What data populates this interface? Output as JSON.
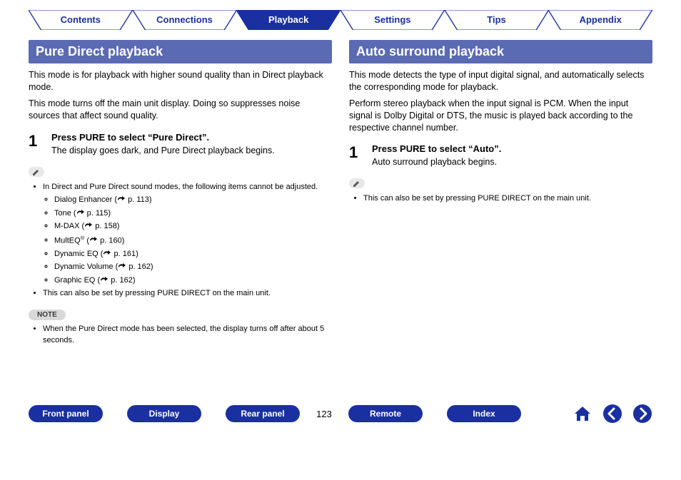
{
  "tabs": [
    {
      "label": "Contents",
      "active": false
    },
    {
      "label": "Connections",
      "active": false
    },
    {
      "label": "Playback",
      "active": true
    },
    {
      "label": "Settings",
      "active": false
    },
    {
      "label": "Tips",
      "active": false
    },
    {
      "label": "Appendix",
      "active": false
    }
  ],
  "left": {
    "heading": "Pure Direct playback",
    "p1": "This mode is for playback with higher sound quality than in Direct playback mode.",
    "p2": "This mode turns off the main unit display. Doing so suppresses noise sources that affect sound quality.",
    "step": {
      "num": "1",
      "title": "Press PURE to select “Pure Direct”.",
      "text": "The display goes dark, and Pure Direct playback begins."
    },
    "notes_intro": "In Direct and Pure Direct sound modes, the following items cannot be adjusted.",
    "sub_items": [
      {
        "name": "Dialog Enhancer",
        "page": "p. 113"
      },
      {
        "name": "Tone",
        "page": "p. 115"
      },
      {
        "name": "M-DAX",
        "page": "p. 158"
      },
      {
        "name": "MultEQ",
        "sup": "®",
        "page": "p. 160"
      },
      {
        "name": "Dynamic EQ",
        "page": "p. 161"
      },
      {
        "name": "Dynamic Volume",
        "page": "p. 162"
      },
      {
        "name": "Graphic EQ",
        "page": "p. 162"
      }
    ],
    "notes_outro": "This can also be set by pressing PURE DIRECT on the main unit.",
    "note_label": "NOTE",
    "note_text": "When the Pure Direct mode has been selected, the display turns off after about 5 seconds."
  },
  "right": {
    "heading": "Auto surround playback",
    "p1": "This mode detects the type of input digital signal, and automatically selects the corresponding mode for playback.",
    "p2": "Perform stereo playback when the input signal is PCM. When the input signal is Dolby Digital or DTS, the music is played back according to the respective channel number.",
    "step": {
      "num": "1",
      "title": "Press PURE to select “Auto”.",
      "text": "Auto surround playback begins."
    },
    "note_item": "This can also be set by pressing PURE DIRECT on the main unit."
  },
  "footer": {
    "buttons": [
      "Front panel",
      "Display",
      "Rear panel"
    ],
    "page": "123",
    "buttons2": [
      "Remote",
      "Index"
    ]
  }
}
